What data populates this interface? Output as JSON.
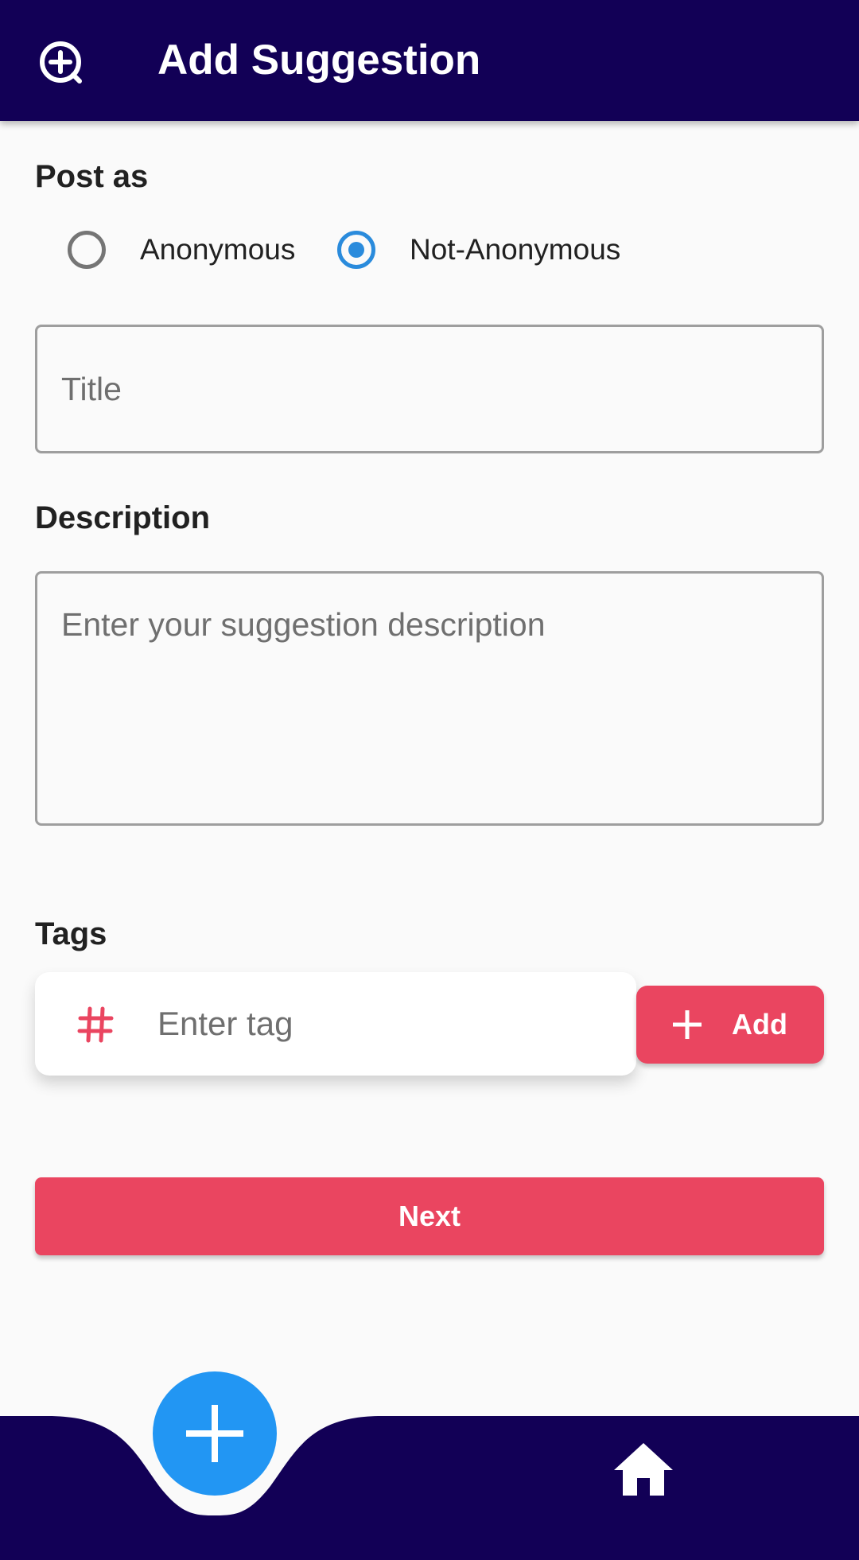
{
  "app_bar": {
    "icon": "add-circle-icon",
    "title": "Add Suggestion",
    "background": "#120056"
  },
  "post_as": {
    "label": "Post as",
    "options": [
      {
        "label": "Anonymous",
        "selected": false
      },
      {
        "label": "Not-Anonymous",
        "selected": true
      }
    ]
  },
  "title_field": {
    "placeholder": "Title",
    "value": ""
  },
  "description": {
    "label": "Description",
    "placeholder": "Enter your suggestion description",
    "value": ""
  },
  "tags": {
    "label": "Tags",
    "icon": "hashtag-icon",
    "placeholder": "Enter tag",
    "value": "",
    "add_label": "Add"
  },
  "next_label": "Next",
  "bottom_nav": {
    "items": [
      "add-icon",
      "home-icon"
    ],
    "background": "#120056",
    "fab_color": "#2296f3"
  },
  "colors": {
    "accent": "#ea4560",
    "radio_selected": "#2a8bdc"
  }
}
